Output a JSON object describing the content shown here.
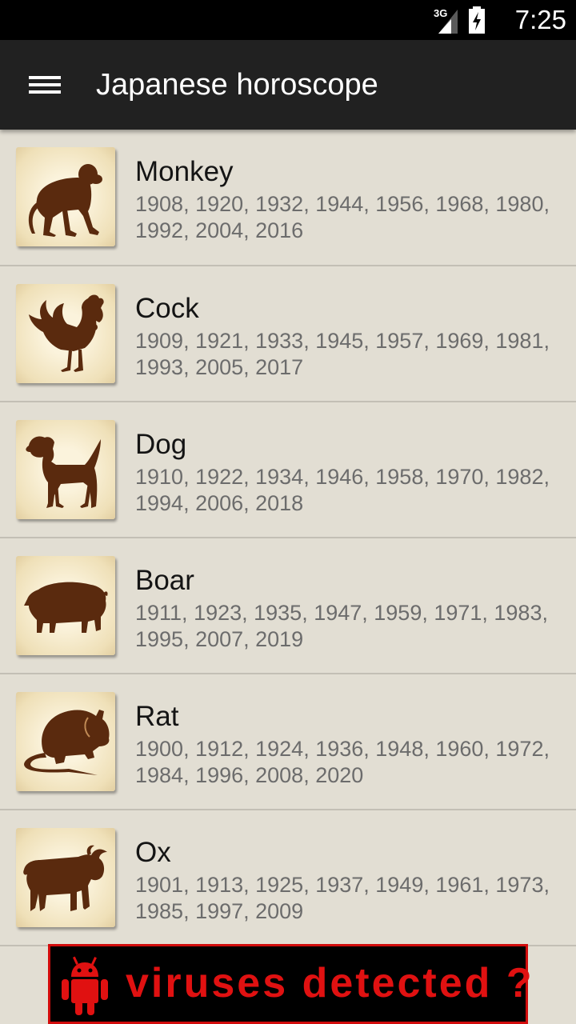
{
  "status_bar": {
    "network": "3G",
    "time": "7:25"
  },
  "app_bar": {
    "title": "Japanese horoscope"
  },
  "signs": [
    {
      "name": "Monkey",
      "years": "1908, 1920, 1932, 1944, 1956, 1968, 1980, 1992, 2004, 2016",
      "icon": "monkey-icon"
    },
    {
      "name": "Cock",
      "years": "1909, 1921, 1933, 1945, 1957, 1969, 1981, 1993, 2005, 2017",
      "icon": "rooster-icon"
    },
    {
      "name": "Dog",
      "years": "1910, 1922, 1934, 1946, 1958, 1970, 1982, 1994, 2006, 2018",
      "icon": "dog-icon"
    },
    {
      "name": "Boar",
      "years": "1911, 1923, 1935, 1947, 1959, 1971, 1983, 1995, 2007, 2019",
      "icon": "boar-icon"
    },
    {
      "name": "Rat",
      "years": "1900, 1912, 1924, 1936, 1948, 1960, 1972, 1984, 1996, 2008, 2020",
      "icon": "rat-icon"
    },
    {
      "name": "Ox",
      "years": "1901, 1913, 1925, 1937, 1949, 1961, 1973, 1985, 1997, 2009",
      "icon": "ox-icon"
    }
  ],
  "ad_banner": {
    "text": "viruses detected ?",
    "icon": "android-icon"
  },
  "colors": {
    "background": "#e2ded3",
    "app_bar": "#212121",
    "silhouette": "#5a2a0e",
    "ad_text": "#e01111"
  }
}
